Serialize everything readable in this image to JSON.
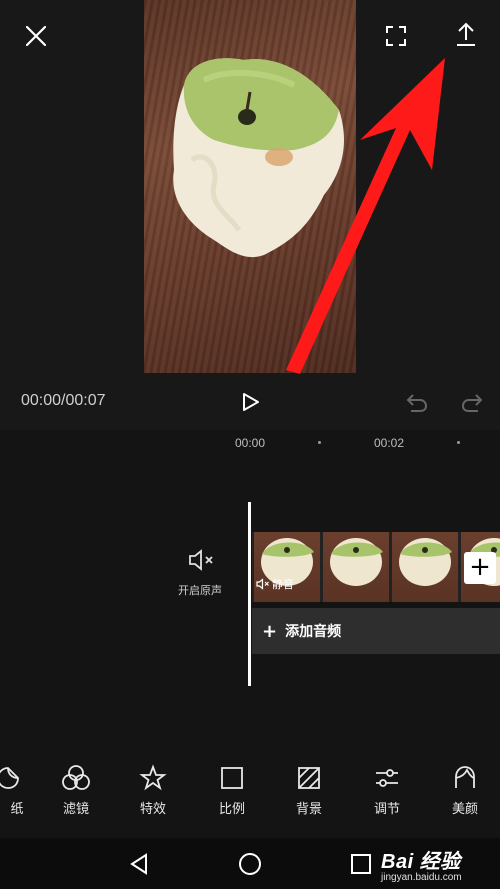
{
  "header": {
    "close_icon": "close-icon",
    "fullscreen_icon": "fullscreen-icon",
    "export_icon": "export-upload-icon"
  },
  "player": {
    "time": "00:00/00:07",
    "play_icon": "play-icon",
    "undo_icon": "undo-icon",
    "redo_icon": "redo-icon"
  },
  "ruler": {
    "ticks": [
      "00:00",
      "00:02"
    ]
  },
  "timeline": {
    "mute_label": "开启原声",
    "mute_icon": "speaker-mute-icon",
    "clip_mute_tag": "静音",
    "add_clip_icon": "plus-icon",
    "add_audio_label": "添加音频",
    "add_audio_icon": "+"
  },
  "toolbar": {
    "items": [
      {
        "label": "纸",
        "icon": "sticker-icon"
      },
      {
        "label": "滤镜",
        "icon": "filter-icon"
      },
      {
        "label": "特效",
        "icon": "effects-star-icon"
      },
      {
        "label": "比例",
        "icon": "ratio-square-icon"
      },
      {
        "label": "背景",
        "icon": "background-icon"
      },
      {
        "label": "调节",
        "icon": "adjust-sliders-icon"
      },
      {
        "label": "美颜",
        "icon": "beauty-face-icon"
      }
    ]
  },
  "navbar": {
    "back_icon": "nav-back-icon",
    "home_icon": "nav-home-icon",
    "recents_icon": "nav-recents-icon"
  },
  "watermark": {
    "main": "Bai 经验",
    "sub": "jingyan.baidu.com"
  },
  "colors": {
    "annotation_arrow": "#ff1a1a",
    "background": "#181818"
  }
}
